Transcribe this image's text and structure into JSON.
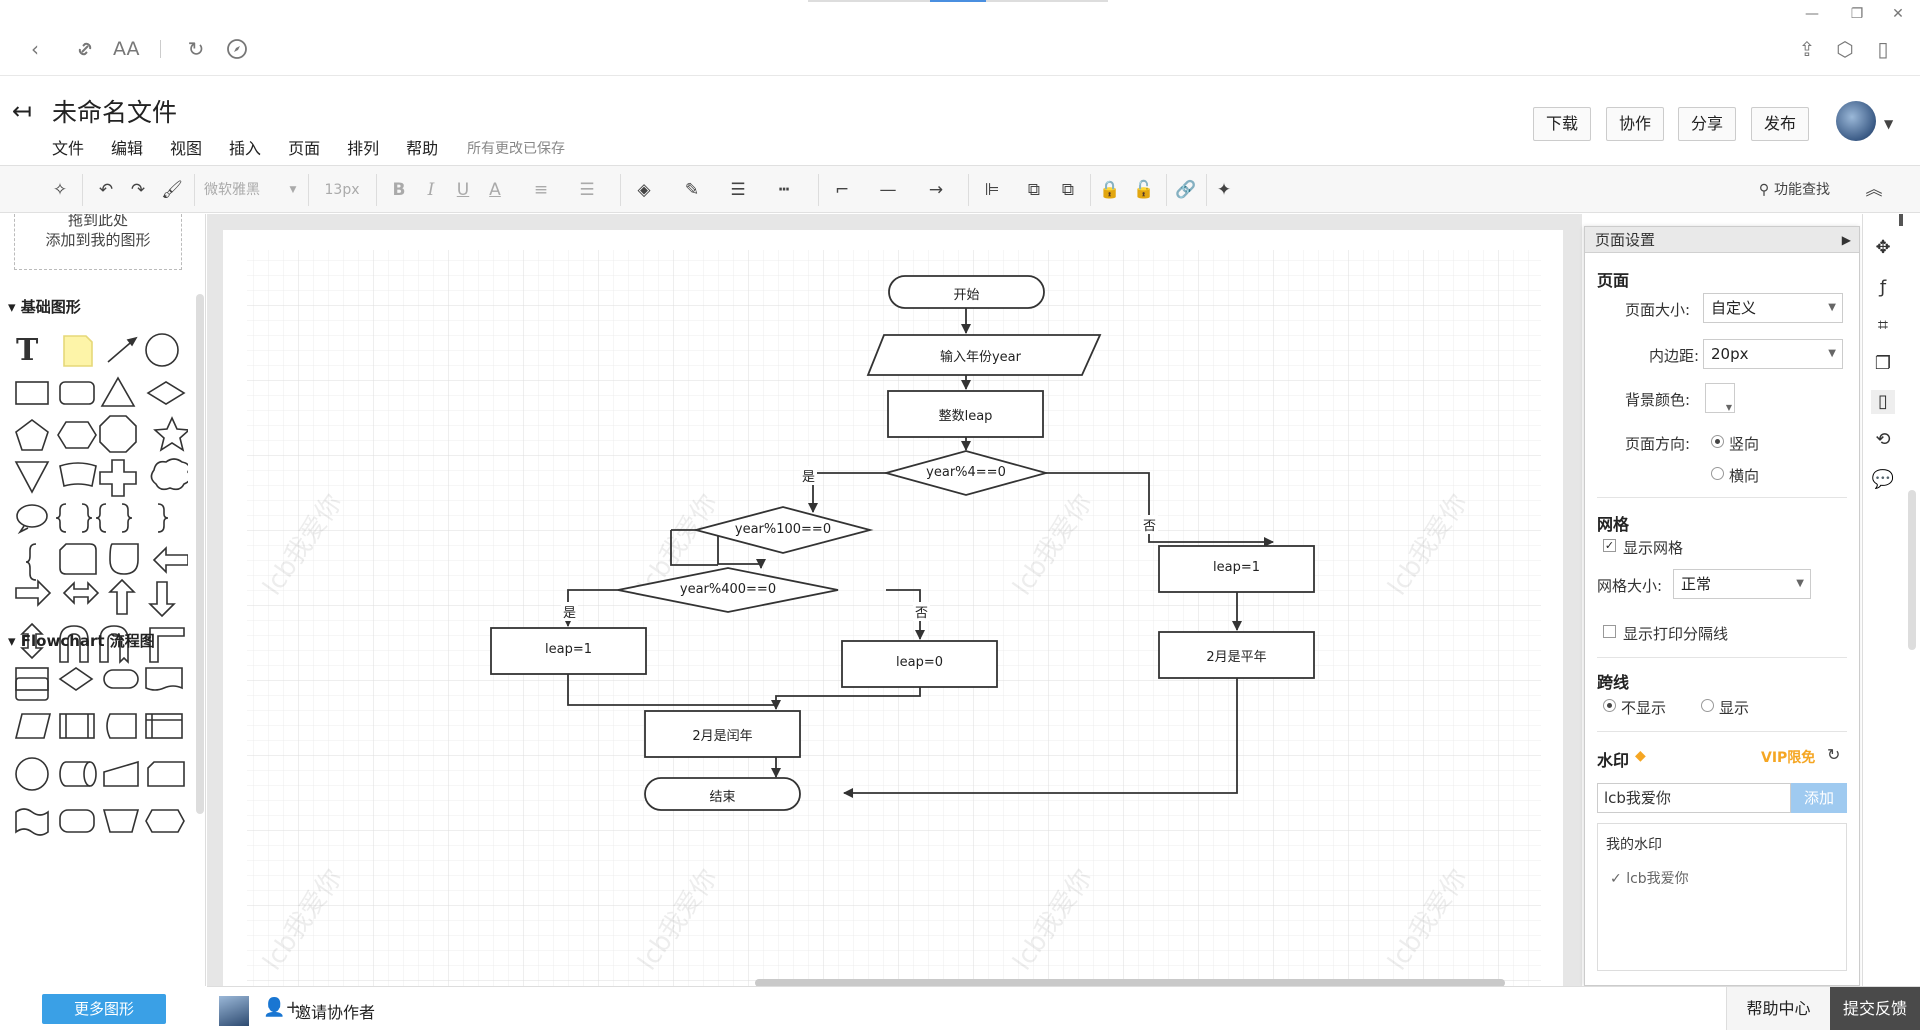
{
  "browser": {
    "icons": [
      "back-icon",
      "link-icon",
      "font-size-icon",
      "refresh-icon",
      "compass-icon"
    ],
    "right_icons": [
      "share-icon",
      "cube-icon",
      "phone-icon"
    ]
  },
  "header": {
    "title": "未命名文件",
    "menu": [
      "文件",
      "编辑",
      "视图",
      "插入",
      "页面",
      "排列",
      "帮助"
    ],
    "saved_status": "所有更改已保存",
    "buttons": {
      "download": "下载",
      "collab": "协作",
      "share": "分享",
      "publish": "发布"
    }
  },
  "toolbar": {
    "font": "微软雅黑",
    "font_size": "13px",
    "search": "功能查找"
  },
  "left_panel": {
    "drop_line1": "拖到此处",
    "drop_line2": "添加到我的图形",
    "section_basic": "基础图形",
    "section_flow": "Flowchart 流程图",
    "more": "更多图形"
  },
  "diagram": {
    "start": "开始",
    "input": "输入年份year",
    "leap": "整数leap",
    "cond1": "year%4==0",
    "cond2": "year%100==0",
    "cond3": "year%400==0",
    "yes1": "是",
    "no1": "否",
    "yes3": "是",
    "no3": "否",
    "leap1_left": "leap=1",
    "leap0": "leap=0",
    "leap1_right": "leap=1",
    "leap_year": "2月是闰年",
    "common_year": "2月是平年",
    "end": "结束",
    "watermark": "lcb我爱你"
  },
  "page_settings": {
    "title": "页面设置",
    "page_heading": "页面",
    "size_label": "页面大小:",
    "size_value": "自定义",
    "padding_label": "内边距:",
    "padding_value": "20px",
    "bg_label": "背景颜色:",
    "orient_label": "页面方向:",
    "orient_portrait": "竖向",
    "orient_landscape": "横向",
    "grid_heading": "网格",
    "show_grid": "显示网格",
    "grid_size_label": "网格大小:",
    "grid_size_value": "正常",
    "print_lines": "显示打印分隔线",
    "jump_heading": "跨线",
    "jump_hide": "不显示",
    "jump_show": "显示",
    "wm_heading": "水印",
    "vip": "VIP限免",
    "wm_value": "lcb我爱你",
    "wm_add": "添加",
    "my_wm": "我的水印",
    "my_wm_item": "lcb我爱你"
  },
  "bottom": {
    "invite": "邀请协作者",
    "help": "帮助中心",
    "feedback": "提交反馈"
  }
}
